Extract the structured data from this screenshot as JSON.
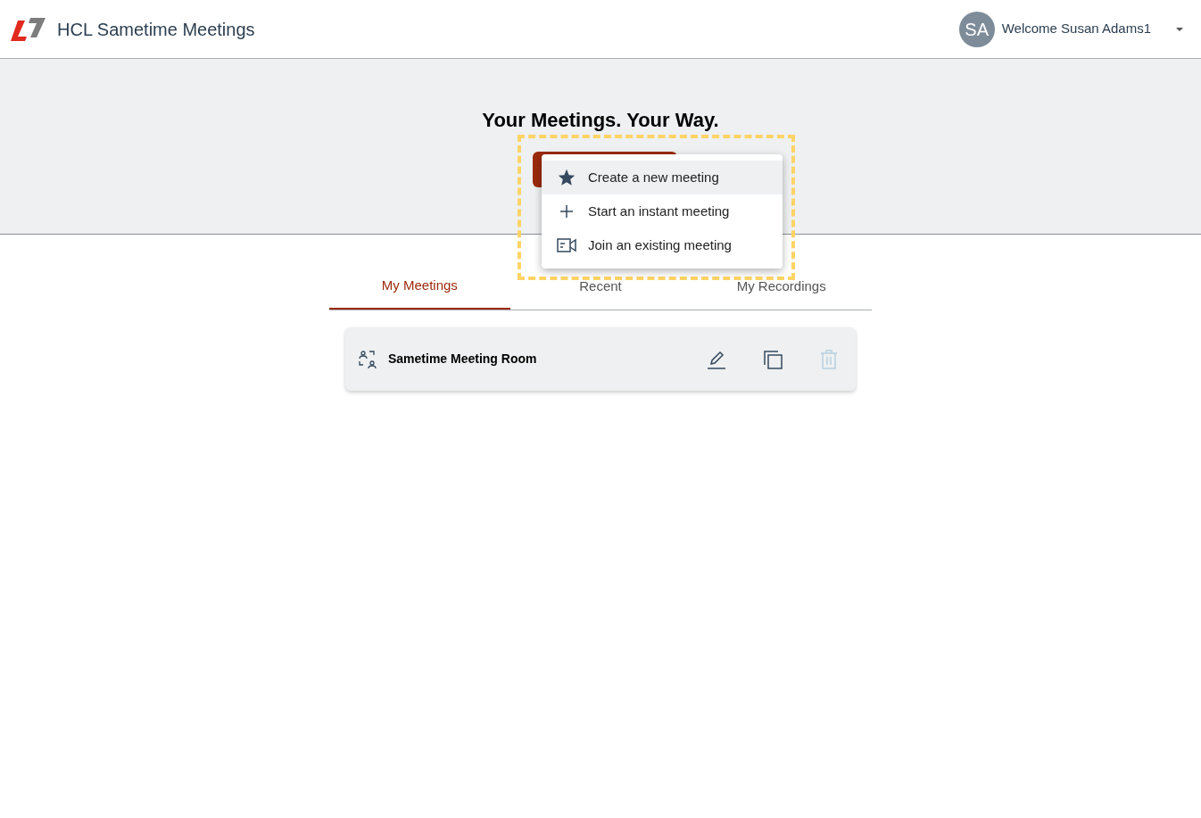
{
  "header": {
    "title": "HCL Sametime Meetings",
    "avatar": "SA",
    "welcome": "Welcome Susan Adams1"
  },
  "hero": {
    "title": "Your Meetings. Your Way."
  },
  "menu": [
    {
      "label": "Create a new meeting",
      "highlighted": true
    },
    {
      "label": "Start an instant meeting",
      "highlighted": false
    },
    {
      "label": "Join an existing meeting",
      "highlighted": false
    }
  ],
  "tabs": [
    {
      "label": "My Meetings",
      "selected": true
    },
    {
      "label": "Recent",
      "selected": false
    },
    {
      "label": "My Recordings",
      "selected": false
    }
  ],
  "meetings": [
    {
      "name": "Sametime Meeting Room",
      "delete_disabled": true
    }
  ]
}
